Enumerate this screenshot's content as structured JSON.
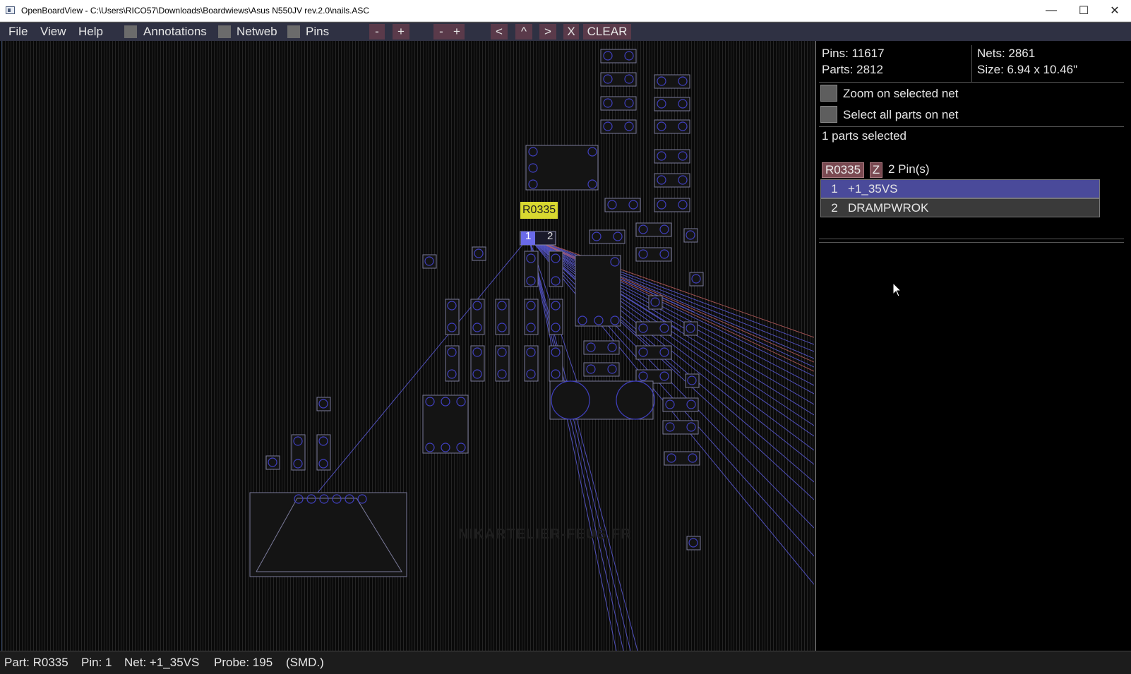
{
  "window": {
    "title": "OpenBoardView - C:\\Users\\RICO57\\Downloads\\Boardwiews\\Asus N550JV rev.2.0\\nails.ASC",
    "controls": {
      "minimize": "—",
      "maximize": "☐",
      "close": "✕"
    }
  },
  "menu": {
    "file": "File",
    "view": "View",
    "help": "Help"
  },
  "toolbar": {
    "annotations": "Annotations",
    "netweb": "Netweb",
    "pins": "Pins",
    "zoom_out": "-",
    "zoom_in": "+",
    "rotate_minus": "-",
    "rotate_plus": "+",
    "left": "<",
    "up": "^",
    "right": ">",
    "x": "X",
    "clear": "CLEAR"
  },
  "board": {
    "selected_part_label": "R0335",
    "pin1": "1",
    "pin2": "2",
    "watermark": "NIKARTELIER-FEUS.FR"
  },
  "stats": {
    "pins": "Pins: 11617",
    "parts": "Parts: 2812",
    "nets": "Nets: 2861",
    "size": "Size: 6.94 x 10.46\""
  },
  "options": {
    "zoom_on_net": "Zoom on selected net",
    "select_all_on_net": "Select all parts on net"
  },
  "selection": {
    "summary": "1 parts selected",
    "part_name": "R0335",
    "z_button": "Z",
    "pin_count": "2 Pin(s)",
    "pins": [
      {
        "num": "1",
        "net": "+1_35VS"
      },
      {
        "num": "2",
        "net": "DRAMPWROK"
      }
    ]
  },
  "status": {
    "part": "Part: R0335",
    "pin": "Pin: 1",
    "net": "Net: +1_35VS",
    "probe": "Probe: 195",
    "type": "(SMD.)"
  },
  "colors": {
    "menu_bg": "#2f3143",
    "button_bg": "#5a3a4a",
    "selected_pin": "#4a4a9a",
    "pad_outline": "#4040c0",
    "highlight": "#e8e830"
  }
}
